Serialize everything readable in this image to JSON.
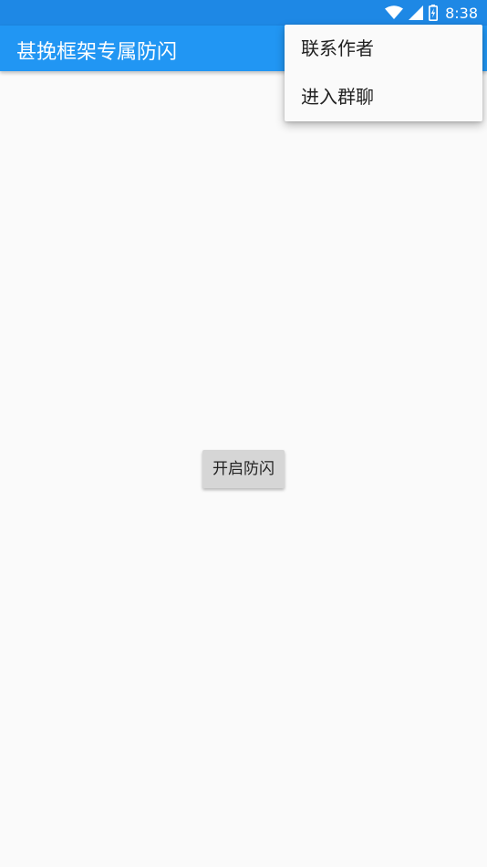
{
  "status_bar": {
    "time": "8:38",
    "icons": [
      "wifi-icon",
      "cell-signal-icon",
      "battery-charging-icon"
    ],
    "background": "#1e88e5"
  },
  "app_bar": {
    "title": "甚挽框架专属防闪",
    "background": "#2196f3"
  },
  "main": {
    "primary_button_label": "开启防闪"
  },
  "overflow_menu": {
    "items": [
      {
        "label": "联系作者"
      },
      {
        "label": "进入群聊"
      }
    ]
  }
}
